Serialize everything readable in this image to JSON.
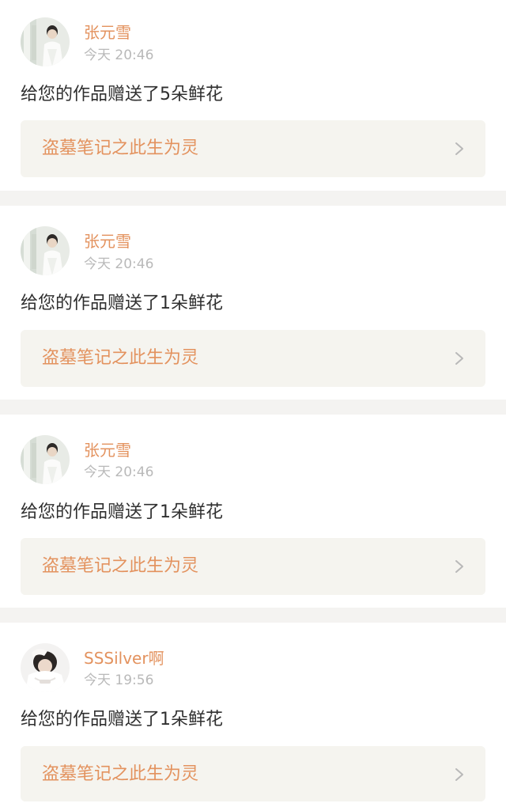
{
  "notifications": [
    {
      "username": "张元雪",
      "time": "今天 20:46",
      "message": "给您的作品赠送了5朵鲜花",
      "work_title": "盗墓笔记之此生为灵"
    },
    {
      "username": "张元雪",
      "time": "今天 20:46",
      "message": "给您的作品赠送了1朵鲜花",
      "work_title": "盗墓笔记之此生为灵"
    },
    {
      "username": "张元雪",
      "time": "今天 20:46",
      "message": "给您的作品赠送了1朵鲜花",
      "work_title": "盗墓笔记之此生为灵"
    },
    {
      "username": "SSSilver啊",
      "time": "今天 19:56",
      "message": "给您的作品赠送了1朵鲜花",
      "work_title": "盗墓笔记之此生为灵"
    }
  ],
  "colors": {
    "accent": "#e3925e",
    "timestamp": "#b9b9b9",
    "message_text": "#2f2f2f",
    "link_card_bg": "#f5f4ef",
    "divider": "#f4f3f1",
    "chevron": "#b8b8b8"
  },
  "icons": {
    "avatar_primary": "user-avatar-photo",
    "link_arrow": "chevron-right-icon"
  }
}
